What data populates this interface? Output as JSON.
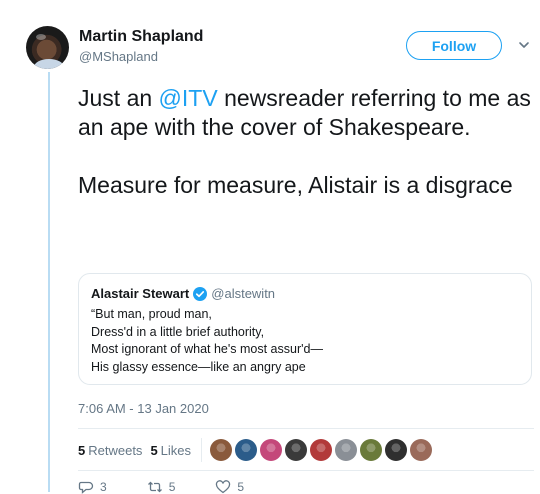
{
  "tweet": {
    "author_name": "Martin Shapland",
    "author_handle": "@MShapland",
    "follow_label": "Follow",
    "text_before_mention": "Just an ",
    "mention": "@ITV",
    "text_after_mention": " newsreader referring to me as an ape with the cover of Shakespeare.",
    "paragraph2": "Measure for measure, Alistair is a disgrace",
    "timestamp": "7:06 AM - 13 Jan 2020"
  },
  "quoted_tweet": {
    "author_name": "Alastair Stewart",
    "author_handle": "@alstewitn",
    "lines": [
      "“But man, proud man,",
      "Dress'd in a little brief authority,",
      "Most ignorant of what he's most assur'd—",
      "His glassy essence—like an angry ape"
    ]
  },
  "stats": {
    "retweets_count": "5",
    "retweets_label": "Retweets",
    "likes_count": "5",
    "likes_label": "Likes"
  },
  "likers": [
    {
      "color": "#8a5a3c"
    },
    {
      "color": "#2b5c8a"
    },
    {
      "color": "#c4487a"
    },
    {
      "color": "#3a3a3a"
    },
    {
      "color": "#b23a3a"
    },
    {
      "color": "#8a8f96"
    },
    {
      "color": "#6a7a3a"
    },
    {
      "color": "#2f2f2f"
    },
    {
      "color": "#9a6a5a"
    }
  ],
  "actions": {
    "reply_count": "3",
    "retweet_count": "5",
    "like_count": "5"
  },
  "icons": {
    "verified": "verified-badge-icon",
    "caret": "chevron-down-icon",
    "reply": "reply-icon",
    "retweet": "retweet-icon",
    "like": "heart-icon"
  },
  "colors": {
    "accent": "#1da1f2",
    "muted": "#657786",
    "thread_line": "#b9dcf3"
  }
}
